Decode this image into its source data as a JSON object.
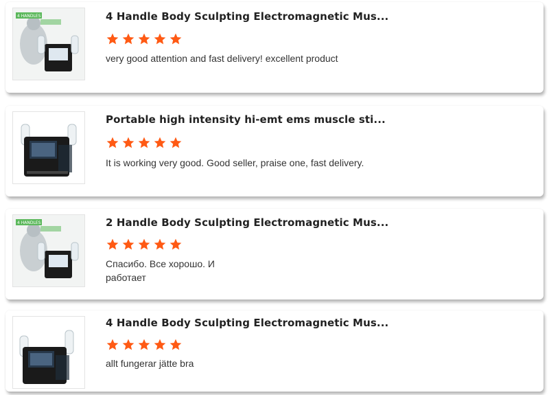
{
  "colors": {
    "star": "#ff5a14",
    "title": "#222222",
    "text": "#333333",
    "badge": "#5cb85c"
  },
  "reviews": [
    {
      "title": "4 Handle Body Sculpting Electromagnetic Mus...",
      "rating": 5,
      "text": "very good attention and fast delivery!  excellent product",
      "thumbnail": "machine-with-model-icon",
      "badge": "4 HANDLES"
    },
    {
      "title": "Portable high intensity hi-emt ems muscle sti...",
      "rating": 5,
      "text": "It is working very good. Good seller, praise one, fast delivery.",
      "thumbnail": "machine-icon"
    },
    {
      "title": "2 Handle Body Sculpting Electromagnetic Mus...",
      "rating": 5,
      "text": "Спасибо. Все хорошо. И\n работает",
      "thumbnail": "machine-with-model-icon",
      "badge": "4 HANDLES"
    },
    {
      "title": "4 Handle Body Sculpting Electromagnetic Mus...",
      "rating": 5,
      "text": "allt fungerar jätte bra",
      "thumbnail": "machine-icon"
    }
  ]
}
